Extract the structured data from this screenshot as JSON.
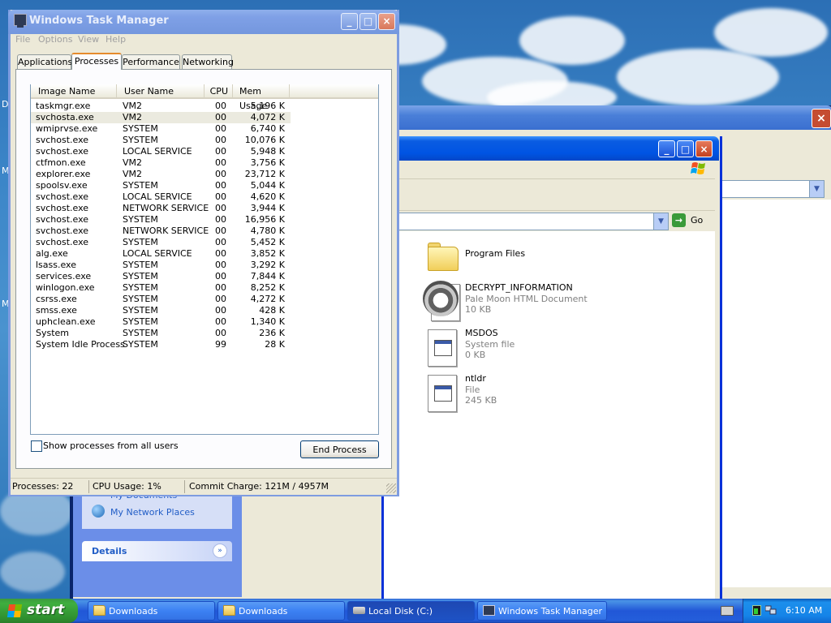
{
  "desktop": {
    "side_chars": [
      "D",
      "M",
      "M"
    ]
  },
  "task_manager": {
    "title": "Windows Task Manager",
    "menu": [
      "File",
      "Options",
      "View",
      "Help"
    ],
    "tabs": [
      "Applications",
      "Processes",
      "Performance",
      "Networking"
    ],
    "active_tab": "Processes",
    "columns": [
      "Image Name",
      "User Name",
      "CPU",
      "Mem Usage"
    ],
    "processes": [
      {
        "name": "taskmgr.exe",
        "user": "VM2",
        "cpu": "00",
        "mem": "5,196 K"
      },
      {
        "name": "svchosta.exe",
        "user": "VM2",
        "cpu": "00",
        "mem": "4,072 K"
      },
      {
        "name": "wmiprvse.exe",
        "user": "SYSTEM",
        "cpu": "00",
        "mem": "6,740 K"
      },
      {
        "name": "svchost.exe",
        "user": "SYSTEM",
        "cpu": "00",
        "mem": "10,076 K"
      },
      {
        "name": "svchost.exe",
        "user": "LOCAL SERVICE",
        "cpu": "00",
        "mem": "5,948 K"
      },
      {
        "name": "ctfmon.exe",
        "user": "VM2",
        "cpu": "00",
        "mem": "3,756 K"
      },
      {
        "name": "explorer.exe",
        "user": "VM2",
        "cpu": "00",
        "mem": "23,712 K"
      },
      {
        "name": "spoolsv.exe",
        "user": "SYSTEM",
        "cpu": "00",
        "mem": "5,044 K"
      },
      {
        "name": "svchost.exe",
        "user": "LOCAL SERVICE",
        "cpu": "00",
        "mem": "4,620 K"
      },
      {
        "name": "svchost.exe",
        "user": "NETWORK SERVICE",
        "cpu": "00",
        "mem": "3,944 K"
      },
      {
        "name": "svchost.exe",
        "user": "SYSTEM",
        "cpu": "00",
        "mem": "16,956 K"
      },
      {
        "name": "svchost.exe",
        "user": "NETWORK SERVICE",
        "cpu": "00",
        "mem": "4,780 K"
      },
      {
        "name": "svchost.exe",
        "user": "SYSTEM",
        "cpu": "00",
        "mem": "5,452 K"
      },
      {
        "name": "alg.exe",
        "user": "LOCAL SERVICE",
        "cpu": "00",
        "mem": "3,852 K"
      },
      {
        "name": "lsass.exe",
        "user": "SYSTEM",
        "cpu": "00",
        "mem": "3,292 K"
      },
      {
        "name": "services.exe",
        "user": "SYSTEM",
        "cpu": "00",
        "mem": "7,844 K"
      },
      {
        "name": "winlogon.exe",
        "user": "SYSTEM",
        "cpu": "00",
        "mem": "8,252 K"
      },
      {
        "name": "csrss.exe",
        "user": "SYSTEM",
        "cpu": "00",
        "mem": "4,272 K"
      },
      {
        "name": "smss.exe",
        "user": "SYSTEM",
        "cpu": "00",
        "mem": "428 K"
      },
      {
        "name": "uphclean.exe",
        "user": "SYSTEM",
        "cpu": "00",
        "mem": "1,340 K"
      },
      {
        "name": "System",
        "user": "SYSTEM",
        "cpu": "00",
        "mem": "236 K"
      },
      {
        "name": "System Idle Process",
        "user": "SYSTEM",
        "cpu": "99",
        "mem": "28 K"
      }
    ],
    "selected_row": 1,
    "show_all_label": "Show processes from all users",
    "show_all_checked": false,
    "end_process_label": "End Process",
    "status": {
      "processes": "Processes: 22",
      "cpu_usage": "CPU Usage: 1%",
      "commit_charge": "Commit Charge: 121M / 4957M"
    }
  },
  "explorer": {
    "go_label": "Go",
    "files": [
      {
        "name": "Program Files",
        "type": "",
        "size": "",
        "icon": "folder-icon"
      },
      {
        "name": "DECRYPT_INFORMATION",
        "type": "Pale Moon HTML Document",
        "size": "10 KB",
        "icon": "raccoon-html-icon"
      },
      {
        "name": "MSDOS",
        "type": "System file",
        "size": "0 KB",
        "icon": "system-file-icon"
      },
      {
        "name": "ntldr",
        "type": "File",
        "size": "245 KB",
        "icon": "system-file-icon"
      }
    ],
    "task_pane": {
      "my_documents": "My Documents",
      "my_network_places": "My Network Places",
      "details_header": "Details"
    }
  },
  "taskbar": {
    "start_label": "start",
    "buttons": [
      {
        "label": "Downloads",
        "icon": "folder-icon",
        "active": false
      },
      {
        "label": "Downloads",
        "icon": "folder-icon",
        "active": false
      },
      {
        "label": "Local Disk (C:)",
        "icon": "drive-icon",
        "active": true
      },
      {
        "label": "Windows Task Manager",
        "icon": "task-manager-icon",
        "active": false
      }
    ],
    "clock": "6:10 AM"
  },
  "colors": {
    "taskbar_blue": "#245edb",
    "start_green": "#3fae3f",
    "xp_title_blue": "#0054e3",
    "inactive_title": "#7fa0e6",
    "close_red": "#c4401f",
    "tab_highlight": "#e68b2c"
  }
}
